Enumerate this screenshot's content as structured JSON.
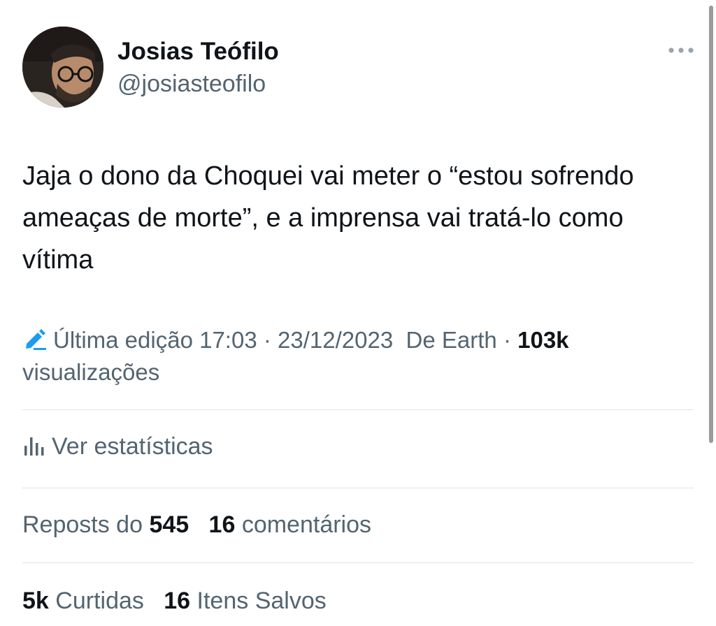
{
  "user": {
    "display_name": "Josias Teófilo",
    "handle": "@josiasteofilo",
    "avatar_icon": "user-avatar-photo"
  },
  "post": {
    "text": "Jaja o dono da Choquei vai meter o “estou sofrendo ameaças de morte”, e a imprensa vai tratá-lo como vítima"
  },
  "meta": {
    "edit_icon": "pencil-edit-icon",
    "edited_label": "Última edição",
    "time": "17:03",
    "separator": "·",
    "date": "23/12/2023",
    "source": "De Earth",
    "views_count": "103k",
    "views_label": "visualizações"
  },
  "actions": {
    "stats_icon": "bar-chart-icon",
    "stats_label": "Ver estatísticas",
    "more_icon": "more-options-icon"
  },
  "counts": {
    "reposts_label": "Reposts do",
    "reposts_count": "545",
    "comments_count": "16",
    "comments_label": "comentários",
    "likes_count": "5k",
    "likes_label": "Curtidas",
    "saves_count": "16",
    "saves_label": "Itens Salvos"
  },
  "colors": {
    "text_primary": "#0f1419",
    "text_secondary": "#536471",
    "accent_blue": "#1d9bf0",
    "divider": "#dfe3e6"
  }
}
